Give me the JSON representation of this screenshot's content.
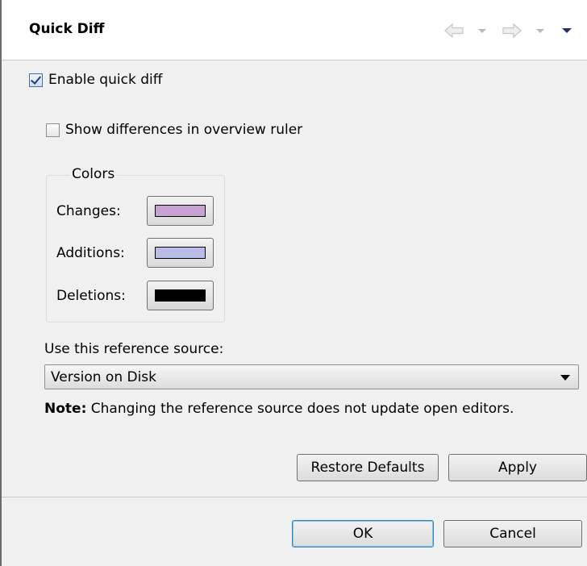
{
  "header": {
    "title": "Quick Diff"
  },
  "options": {
    "enable_quick_diff": {
      "label": "Enable quick diff",
      "checked": true
    },
    "show_overview_ruler": {
      "label": "Show differences in overview ruler",
      "checked": false
    }
  },
  "colors": {
    "group_label": "Colors",
    "changes": {
      "label": "Changes:",
      "color": "#c8a2d2"
    },
    "additions": {
      "label": "Additions:",
      "color": "#b9bce6"
    },
    "deletions": {
      "label": "Deletions:",
      "color": "#000000"
    }
  },
  "reference": {
    "label": "Use this reference source:",
    "selected": "Version on Disk",
    "note_prefix": "Note:",
    "note_text": "Changing the reference source does not update open editors."
  },
  "buttons": {
    "restore_defaults": "Restore Defaults",
    "apply": "Apply",
    "ok": "OK",
    "cancel": "Cancel"
  },
  "icons": {
    "back": "back-arrow-icon",
    "forward": "forward-arrow-icon",
    "view_menu": "view-menu-icon"
  }
}
